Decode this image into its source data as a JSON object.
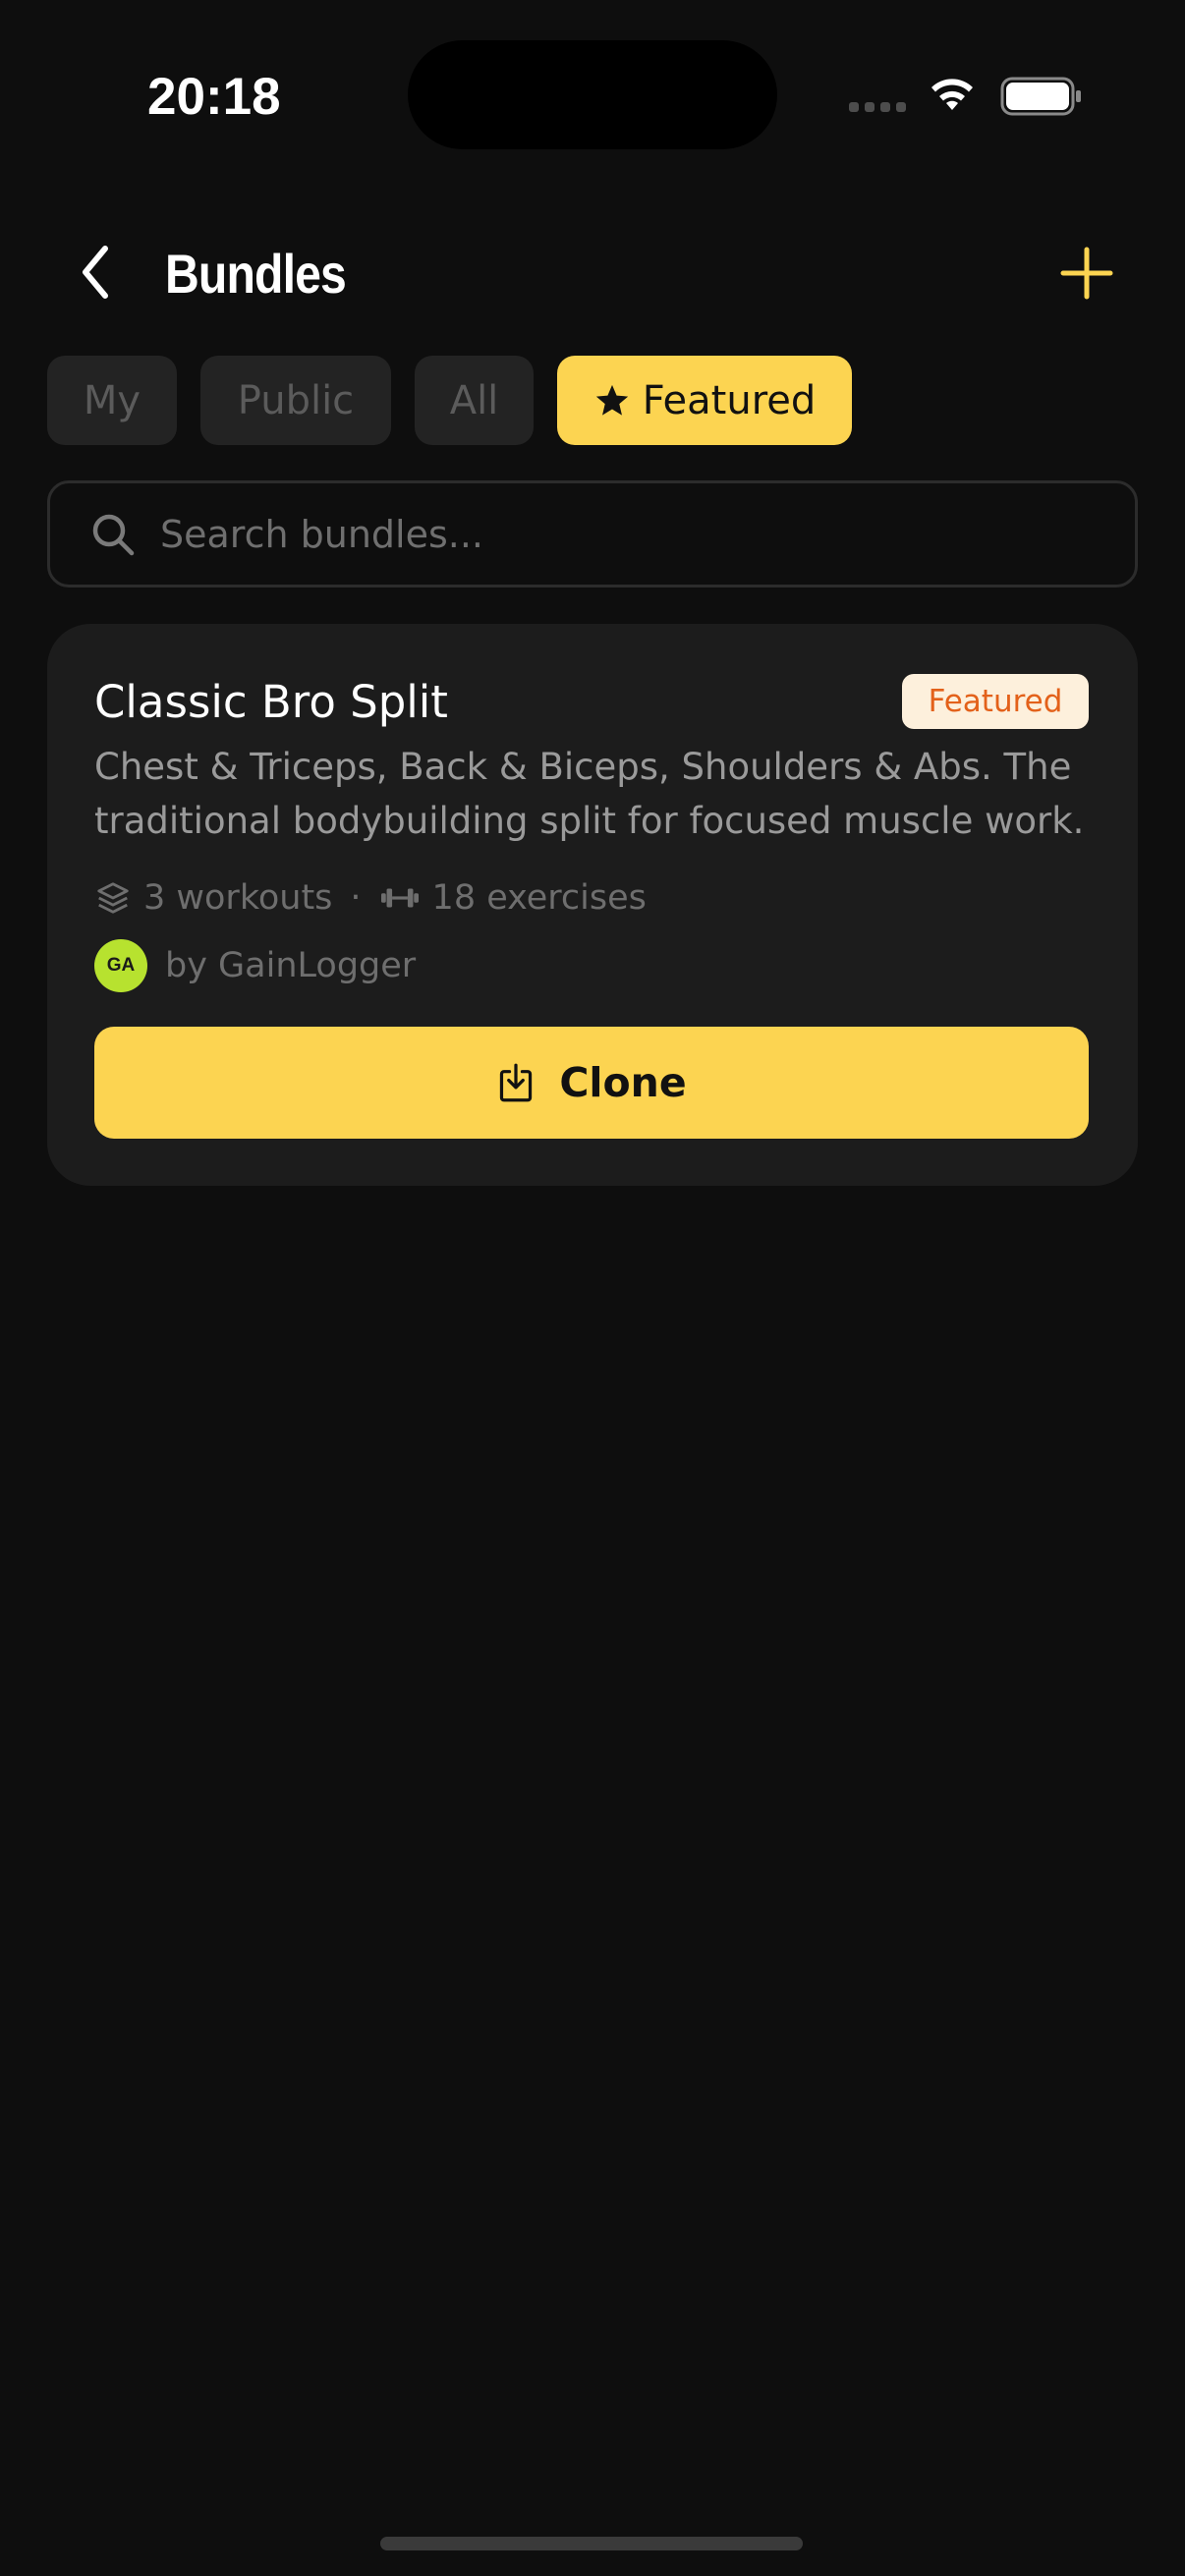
{
  "status_bar": {
    "time": "20:18"
  },
  "header": {
    "title": "Bundles"
  },
  "tabs": [
    {
      "label": "My",
      "active": false
    },
    {
      "label": "Public",
      "active": false
    },
    {
      "label": "All",
      "active": false
    },
    {
      "label": "Featured",
      "active": true,
      "icon": "star-icon"
    }
  ],
  "search": {
    "placeholder": "Search bundles...",
    "value": ""
  },
  "bundles": [
    {
      "title": "Classic Bro Split",
      "badge": "Featured",
      "description": "Chest & Triceps, Back & Biceps, Shoulders & Abs. The traditional bodybuilding split for focused muscle work.",
      "workouts": "3 workouts",
      "separator": "·",
      "exercises": "18 exercises",
      "author_initials": "GA",
      "author": "by GainLogger",
      "clone_label": "Clone"
    }
  ],
  "colors": {
    "background": "#0e0e0e",
    "card": "#1c1c1c",
    "accent": "#fcd451",
    "badge_text": "#e3611a",
    "badge_bg": "#fdf0dc",
    "avatar": "#b7e22f"
  }
}
